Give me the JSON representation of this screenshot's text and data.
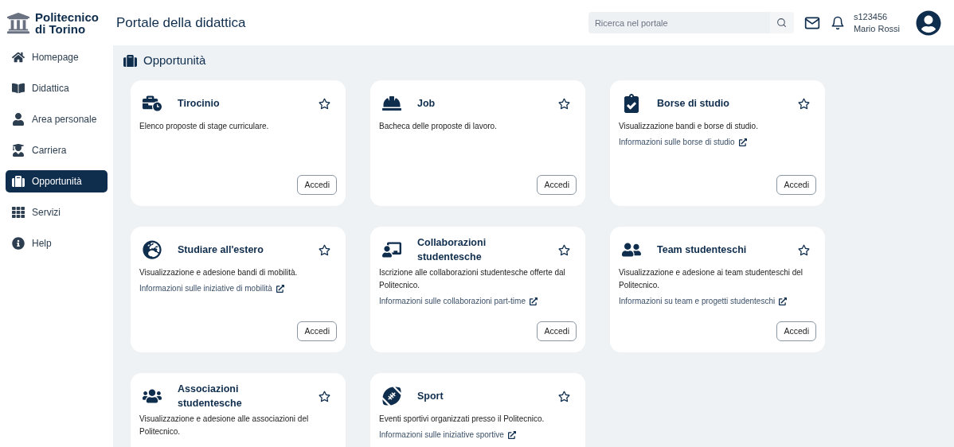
{
  "header": {
    "logo_line1": "Politecnico",
    "logo_line2": "di Torino",
    "title": "Portale della didattica",
    "search": {
      "placeholder": "Ricerca nel portale"
    },
    "user": {
      "id": "s123456",
      "name": "Mario Rossi"
    }
  },
  "sidebar": {
    "items": [
      {
        "label": "Homepage",
        "selected": false
      },
      {
        "label": "Didattica",
        "selected": false
      },
      {
        "label": "Area personale",
        "selected": false
      },
      {
        "label": "Carriera",
        "selected": false
      },
      {
        "label": "Opportunità",
        "selected": true
      },
      {
        "label": "Servizi",
        "selected": false
      },
      {
        "label": "Help",
        "selected": false
      }
    ]
  },
  "page": {
    "title": "Opportunità"
  },
  "cards": [
    {
      "title": "Tirocinio",
      "favorite": false,
      "description": "Elenco proposte di stage curriculare.",
      "button": "Accedi"
    },
    {
      "title": "Job",
      "favorite": false,
      "description": "Bacheca delle proposte di lavoro.",
      "button": "Accedi"
    },
    {
      "title": "Borse di studio",
      "favorite": false,
      "description": "Visualizzazione bandi e borse di studio.",
      "link": "Informazioni sulle borse di studio",
      "button": "Accedi"
    },
    {
      "title": "Studiare all'estero",
      "favorite": false,
      "description": "Visualizzazione e adesione bandi di mobilità.",
      "link": "Informazioni sulle iniziative di mobilità",
      "button": "Accedi"
    },
    {
      "title": "Collaborazioni studentesche",
      "favorite": false,
      "description": "Iscrizione alle collaborazioni studentesche offerte dal Politecnico.",
      "link": "Informazioni sulle collaborazioni part-time",
      "button": "Accedi"
    },
    {
      "title": "Team studenteschi",
      "favorite": false,
      "description": "Visualizzazione e adesione ai team studenteschi del Politecnico.",
      "link": "Informazioni su team e progetti studenteschi",
      "button": "Accedi"
    },
    {
      "title": "Associazioni studentesche",
      "favorite": false,
      "description": "Visualizzazione e adesione alle associazioni del Politecnico."
    },
    {
      "title": "Sport",
      "favorite": false,
      "description": "Eventi sportivi organizzati presso il Politecnico.",
      "link": "Informazioni sulle iniziative sportive"
    }
  ]
}
